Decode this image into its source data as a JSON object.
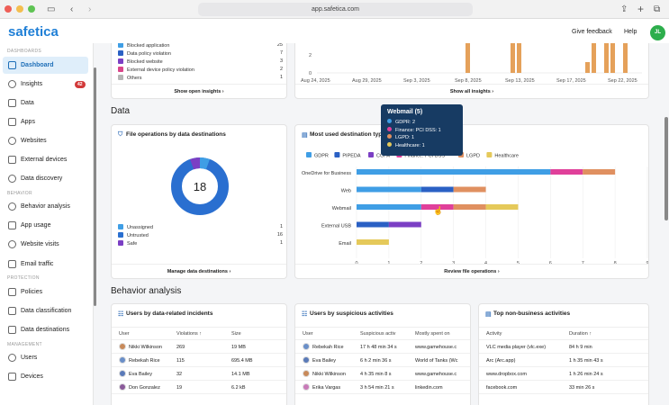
{
  "browser": {
    "url": "app.safetica.com"
  },
  "topbar": {
    "logo": "safetica",
    "give_feedback": "Give feedback",
    "help": "Help",
    "avatar": "JL"
  },
  "sidebar": {
    "sections": [
      "DASHBOARDS",
      "BEHAVIOR",
      "PROTECTION",
      "MANAGEMENT"
    ],
    "items": [
      {
        "label": "Dashboard",
        "icon": "dashboard-icon"
      },
      {
        "label": "Insights",
        "icon": "bulb-icon",
        "badge": "42"
      },
      {
        "label": "Data",
        "icon": "document-icon"
      },
      {
        "label": "Apps",
        "icon": "apps-icon"
      },
      {
        "label": "Websites",
        "icon": "globe-icon"
      },
      {
        "label": "External devices",
        "icon": "usb-icon"
      },
      {
        "label": "Data discovery",
        "icon": "search-icon"
      },
      {
        "label": "Behavior analysis",
        "icon": "person-icon"
      },
      {
        "label": "App usage",
        "icon": "apps-icon"
      },
      {
        "label": "Website visits",
        "icon": "globe-icon"
      },
      {
        "label": "Email traffic",
        "icon": "mail-icon"
      },
      {
        "label": "Policies",
        "icon": "shield-icon"
      },
      {
        "label": "Data classification",
        "icon": "tag-icon"
      },
      {
        "label": "Data destinations",
        "icon": "destination-icon"
      },
      {
        "label": "Users",
        "icon": "users-icon"
      },
      {
        "label": "Devices",
        "icon": "device-icon"
      }
    ]
  },
  "insights_card": {
    "legend": [
      {
        "label": "Blocked application",
        "value": "25",
        "color": "#3f9ee5"
      },
      {
        "label": "Data policy violation",
        "value": "7",
        "color": "#2a60c4"
      },
      {
        "label": "Blocked website",
        "value": "3",
        "color": "#7b3fc4"
      },
      {
        "label": "External device policy violation",
        "value": "2",
        "color": "#d9468a"
      },
      {
        "label": "Others",
        "value": "1",
        "color": "#b5b5b5"
      }
    ],
    "footer": "Show open insights"
  },
  "timeline_card": {
    "ylabels": [
      "2",
      "0"
    ],
    "xlabels": [
      "Aug 24, 2025",
      "Aug 29, 2025",
      "Sep 3, 2025",
      "Sep 8, 2025",
      "Sep 13, 2025",
      "Sep 17, 2025",
      "Sep 22, 2025"
    ],
    "footer": "Show all insights",
    "bar_color": "#e5a15a"
  },
  "section_data": "Data",
  "file_ops": {
    "title": "File operations by data destinations",
    "total": "18",
    "legend": [
      {
        "label": "Unassigned",
        "value": "1",
        "color": "#3f9ee5"
      },
      {
        "label": "Untrusted",
        "value": "16",
        "color": "#2a6fd0"
      },
      {
        "label": "Safe",
        "value": "1",
        "color": "#7b3fc4"
      }
    ],
    "footer": "Manage data destinations"
  },
  "dest_types": {
    "title": "Most used destination types by data classification",
    "footer": "Review file operations",
    "tooltip": {
      "title": "Webmail (5)",
      "rows": [
        {
          "label": "GDPR: 2",
          "color": "#3f9ee5"
        },
        {
          "label": "Finance: PCI DSS: 1",
          "color": "#e0409a"
        },
        {
          "label": "LGPD: 1",
          "color": "#e09060"
        },
        {
          "label": "Healthcare: 1",
          "color": "#e5c95a"
        }
      ]
    }
  },
  "chart_data": {
    "type": "bar",
    "orientation": "horizontal",
    "stacked": true,
    "categories": [
      "OneDrive for Business",
      "Web",
      "Webmail",
      "External USB",
      "Email"
    ],
    "series": [
      {
        "name": "GDPR",
        "color": "#3f9ee5",
        "values": [
          6,
          2,
          2,
          0,
          0
        ]
      },
      {
        "name": "PIPEDA",
        "color": "#2a60c4",
        "values": [
          0,
          1,
          0,
          1,
          0
        ]
      },
      {
        "name": "CCPA",
        "color": "#7b3fc4",
        "values": [
          0,
          0,
          0,
          1,
          0
        ]
      },
      {
        "name": "Finance: PCI DSS",
        "color": "#e0409a",
        "values": [
          1,
          0,
          1,
          0,
          0
        ]
      },
      {
        "name": "LGPD",
        "color": "#e09060",
        "values": [
          1,
          1,
          1,
          0,
          0
        ]
      },
      {
        "name": "Healthcare",
        "color": "#e5c95a",
        "values": [
          0,
          0,
          1,
          0,
          1
        ]
      }
    ],
    "xticks": [
      "0",
      "1",
      "2",
      "3",
      "4",
      "5",
      "6",
      "7",
      "8",
      "9"
    ],
    "xlim": [
      0,
      9
    ]
  },
  "section_behavior": "Behavior analysis",
  "incidents": {
    "title": "Users by data-related incidents",
    "columns": [
      "User",
      "Violations",
      "Size"
    ],
    "sort_icon": "↑",
    "rows": [
      {
        "user": "Nikki Wilkinson",
        "violations": "269",
        "size": "19 MB"
      },
      {
        "user": "Rebekah Rice",
        "violations": "115",
        "size": "695.4 MB"
      },
      {
        "user": "Eva Bailey",
        "violations": "32",
        "size": "14.1 MB"
      },
      {
        "user": "Don Gonzalez",
        "violations": "19",
        "size": "6.2 kB"
      }
    ]
  },
  "suspicious": {
    "title": "Users by suspicious activities",
    "columns": [
      "User",
      "Suspicious activ",
      "Mostly spent on"
    ],
    "rows": [
      {
        "user": "Rebekah Rice",
        "activity": "17 h 48 min 34 s",
        "spent": "www.gamehouse.c"
      },
      {
        "user": "Eva Bailey",
        "activity": "6 h 2 min 36 s",
        "spent": "World of Tanks (Wc"
      },
      {
        "user": "Nikki Wilkinson",
        "activity": "4 h 35 min 8 s",
        "spent": "www.gamehouse.c"
      },
      {
        "user": "Erika Vargas",
        "activity": "3 h 54 min 21 s",
        "spent": "linkedin.com"
      }
    ]
  },
  "nonbusiness": {
    "title": "Top non-business activities",
    "columns": [
      "Activity",
      "Duration"
    ],
    "sort_icon": "↑",
    "rows": [
      {
        "activity": "VLC media player (vlc.exe)",
        "duration": "84 h 9 min"
      },
      {
        "activity": "Arc (Arc.app)",
        "duration": "1 h 35 min 43 s"
      },
      {
        "activity": "www.dropbox.com",
        "duration": "1 h 26 min 24 s"
      },
      {
        "activity": "facebook.com",
        "duration": "33 min 26 s"
      }
    ]
  }
}
